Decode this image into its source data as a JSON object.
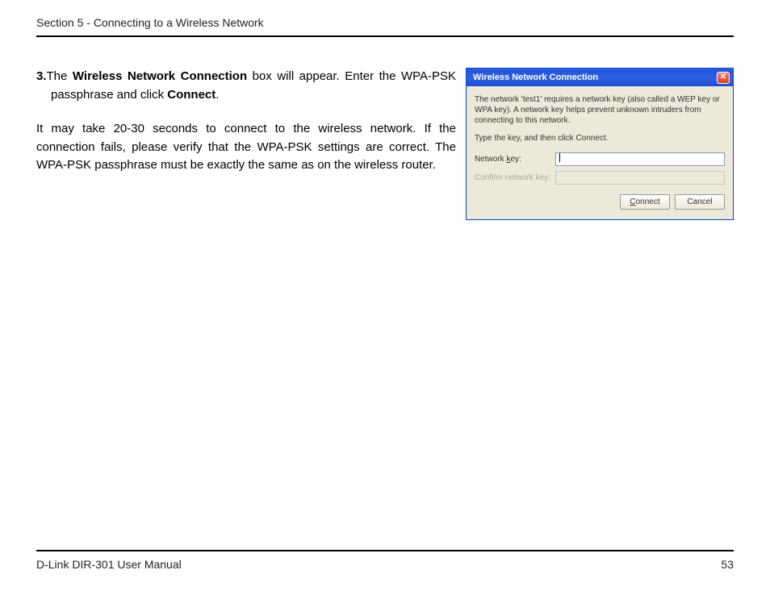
{
  "header": {
    "section_title": "Section 5 - Connecting to a Wireless Network"
  },
  "content": {
    "step_num": "3.",
    "step_pre": "The ",
    "step_bold1": "Wireless Network Connection",
    "step_mid": " box will appear. Enter the WPA-PSK passphrase and click ",
    "step_bold2": "Connect",
    "step_end": ".",
    "paragraph": "It may take 20-30 seconds to connect to the wireless network. If the connection fails, please verify that the WPA-PSK settings are correct. The WPA-PSK passphrase must be exactly the same as on the wireless router."
  },
  "dialog": {
    "title": "Wireless Network Connection",
    "instruction": "The network 'test1' requires a network key (also called a WEP key or WPA key). A network key helps prevent unknown intruders from connecting to this network.",
    "type_prompt": "Type the key, and then click Connect.",
    "network_key_label_pre": "Network ",
    "network_key_label_u": "k",
    "network_key_label_post": "ey:",
    "confirm_label": "Confirm network key:",
    "connect_u": "C",
    "connect_rest": "onnect",
    "cancel": "Cancel"
  },
  "footer": {
    "manual": "D-Link DIR-301 User Manual",
    "page": "53"
  }
}
